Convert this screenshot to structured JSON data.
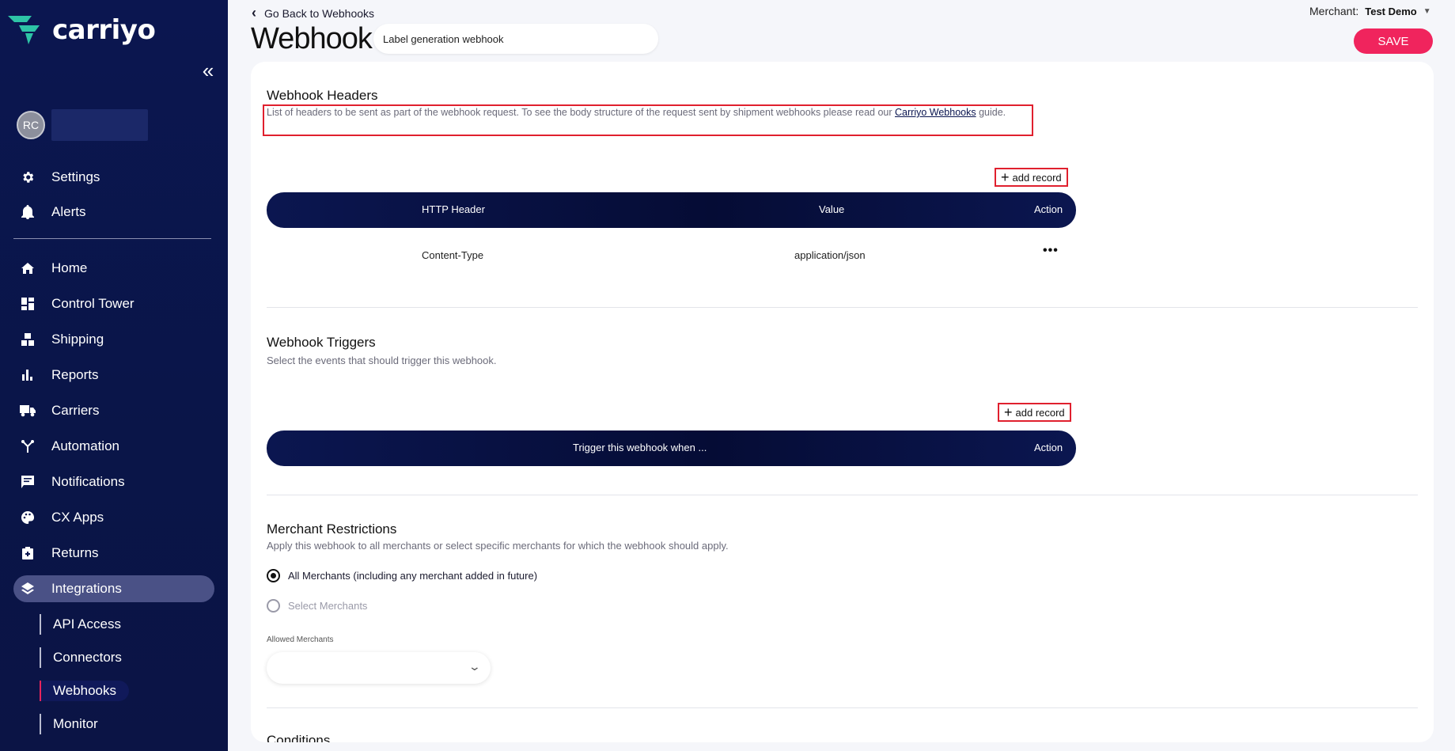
{
  "app": {
    "brand": "carriyo",
    "accent": "#f0245d",
    "sidebar_bg": "#0b1650"
  },
  "sidebar": {
    "collapse_icon": "double-chevron-left-icon",
    "user": {
      "initials": "RC"
    },
    "top_items": [
      {
        "label": "Settings",
        "icon": "gear-icon"
      },
      {
        "label": "Alerts",
        "icon": "bell-icon"
      }
    ],
    "items": [
      {
        "label": "Home",
        "icon": "home-icon"
      },
      {
        "label": "Control Tower",
        "icon": "dashboard-icon"
      },
      {
        "label": "Shipping",
        "icon": "boxes-icon"
      },
      {
        "label": "Reports",
        "icon": "bar-chart-icon"
      },
      {
        "label": "Carriers",
        "icon": "truck-icon"
      },
      {
        "label": "Automation",
        "icon": "automation-icon"
      },
      {
        "label": "Notifications",
        "icon": "message-icon"
      },
      {
        "label": "CX Apps",
        "icon": "palette-icon"
      },
      {
        "label": "Returns",
        "icon": "return-box-icon"
      },
      {
        "label": "Integrations",
        "icon": "layers-icon"
      }
    ],
    "sub_items": [
      {
        "label": "API Access"
      },
      {
        "label": "Connectors"
      },
      {
        "label": "Webhooks"
      },
      {
        "label": "Monitor"
      }
    ]
  },
  "header": {
    "back_label": "Go Back to Webhooks",
    "title": "Webhook",
    "name_value": "Label generation webhook",
    "merchant_label": "Merchant:",
    "merchant_value": "Test Demo",
    "save_label": "SAVE"
  },
  "headers_section": {
    "title": "Webhook Headers",
    "desc_before": "List of headers to be sent as part of the webhook request. To see the body structure of the request sent by shipment webhooks please read our ",
    "desc_link": "Carriyo Webhooks",
    "desc_after": " guide.",
    "add_label": "add record",
    "columns": [
      "HTTP Header",
      "Value",
      "Action"
    ],
    "rows": [
      {
        "header": "Content-Type",
        "value": "application/json"
      }
    ]
  },
  "triggers_section": {
    "title": "Webhook Triggers",
    "desc": "Select the events that should trigger this webhook.",
    "add_label": "add record",
    "columns": [
      "Trigger this webhook when ...",
      "Action"
    ]
  },
  "merchant_section": {
    "title": "Merchant Restrictions",
    "desc": "Apply this webhook to all merchants or select specific merchants for which the webhook should apply.",
    "options": [
      {
        "label": "All Merchants (including any merchant added in future)",
        "selected": true
      },
      {
        "label": "Select Merchants",
        "selected": false
      }
    ],
    "allowed_label": "Allowed Merchants",
    "allowed_value": ""
  },
  "next_section": {
    "title": "Conditions"
  }
}
